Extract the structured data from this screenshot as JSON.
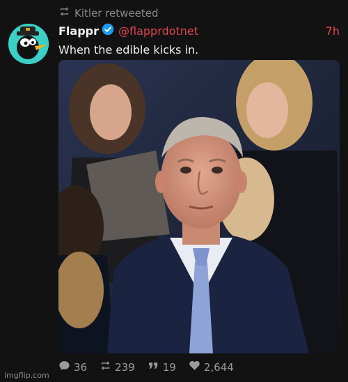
{
  "retweet": {
    "icon": "retweet-icon",
    "text": "Kitler retweeted"
  },
  "author": {
    "name": "Flappr",
    "handle": "@flapprdotnet",
    "time": "7h",
    "avatar_icon": "penguin-avatar-icon",
    "verified_icon": "verified-badge-icon"
  },
  "tweet": {
    "text": "When the edible kicks in."
  },
  "stats": {
    "replies": "36",
    "retweets": "239",
    "quotes": "19",
    "likes": "2,644"
  },
  "watermark": "imgflip.com",
  "colors": {
    "accent": "#e0454e",
    "verified": "#1d9bf0",
    "avatar_bg": "#3ad0c3",
    "background": "#121212"
  }
}
